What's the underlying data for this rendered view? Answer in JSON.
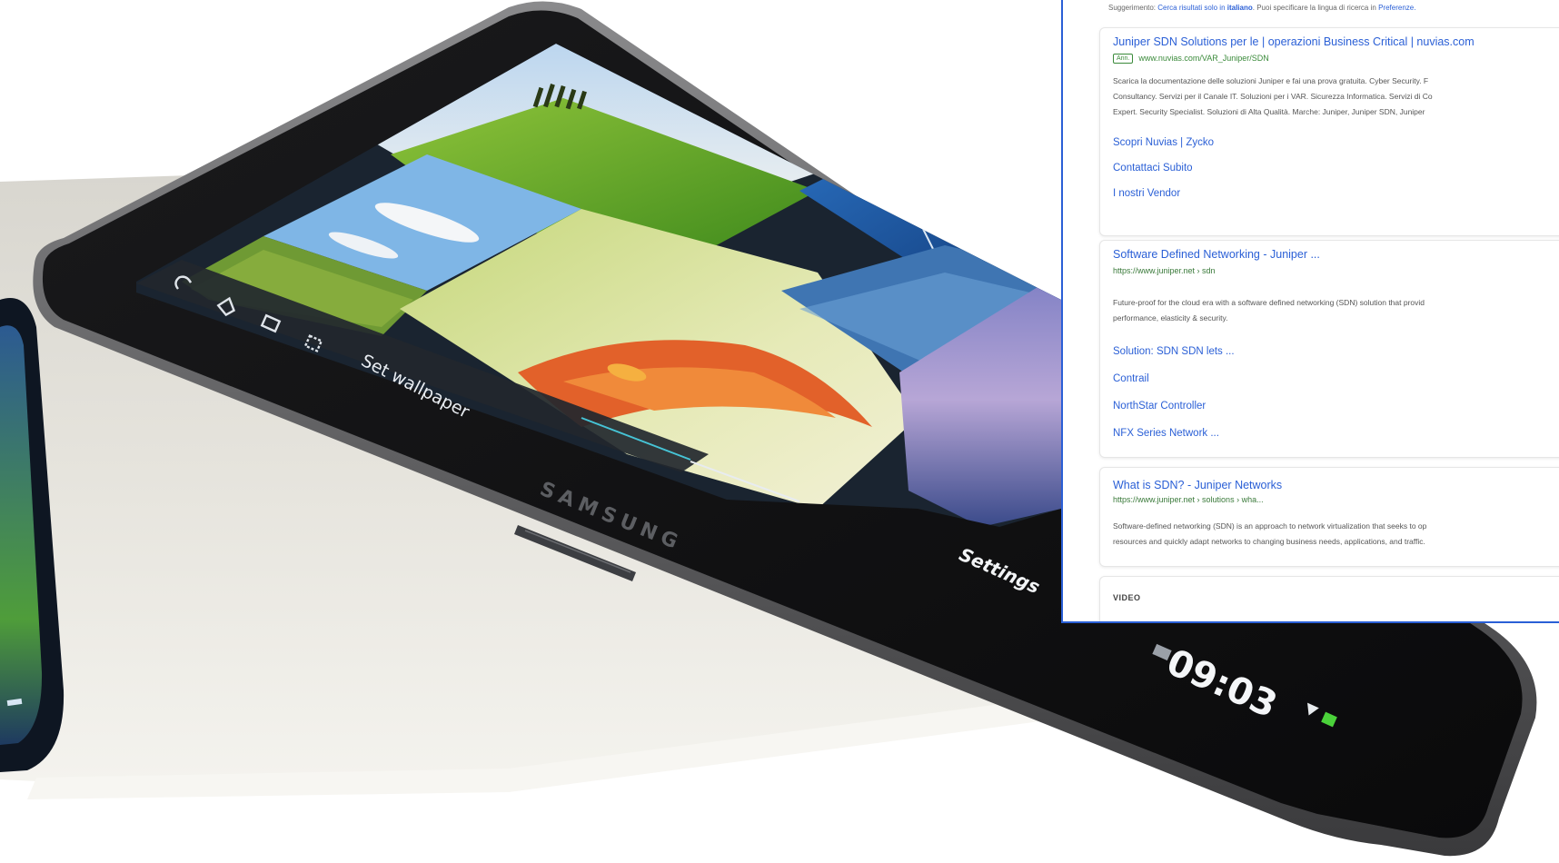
{
  "tablet": {
    "brand": "SAMSUNG",
    "set_wallpaper": "Set wallpaper",
    "settings": "Settings",
    "clock": "09:03"
  },
  "results": {
    "suggestion": {
      "prefix": "Suggerimento:",
      "text": "Cerca risultati solo in",
      "language": "italiano",
      "tail": ". Puoi specificare la lingua di ricerca in",
      "prefs": "Preferenze."
    },
    "items": [
      {
        "title": "Juniper SDN Solutions per le | operazioni Business Critical | nuvias.com",
        "ad": "Ann.",
        "url": "www.nuvias.com/VAR_Juniper/SDN",
        "desc": [
          "Scarica la documentazione delle soluzioni Juniper e fai una prova gratuita. Cyber Security. F",
          "Consultancy. Servizi per il Canale IT. Soluzioni per i VAR. Sicurezza Informatica. Servizi di Co",
          "Expert. Security Specialist. Soluzioni di Alta Qualità. Marche: Juniper, Juniper SDN, Juniper"
        ],
        "sublinks": [
          "Scopri Nuvias | Zycko",
          "Contattaci Subito",
          "I nostri Vendor"
        ]
      },
      {
        "title": "Software Defined Networking - Juniper ...",
        "url": "https://www.juniper.net › sdn",
        "desc": [
          "Future-proof for the cloud era with a software defined networking (SDN) solution that provid",
          "performance, elasticity & security."
        ],
        "sublinks": [
          "Solution: SDN SDN lets ...",
          "Contrail",
          "NorthStar Controller",
          "NFX Series Network ..."
        ]
      },
      {
        "title": "What is SDN? - Juniper Networks",
        "url": "https://www.juniper.net › solutions › wha...",
        "desc": [
          "Software-defined networking (SDN) is an approach to network virtualization that seeks to op",
          "resources and quickly adapt networks to changing business needs, applications, and traffic."
        ]
      }
    ],
    "video_label": "VIDEO"
  }
}
